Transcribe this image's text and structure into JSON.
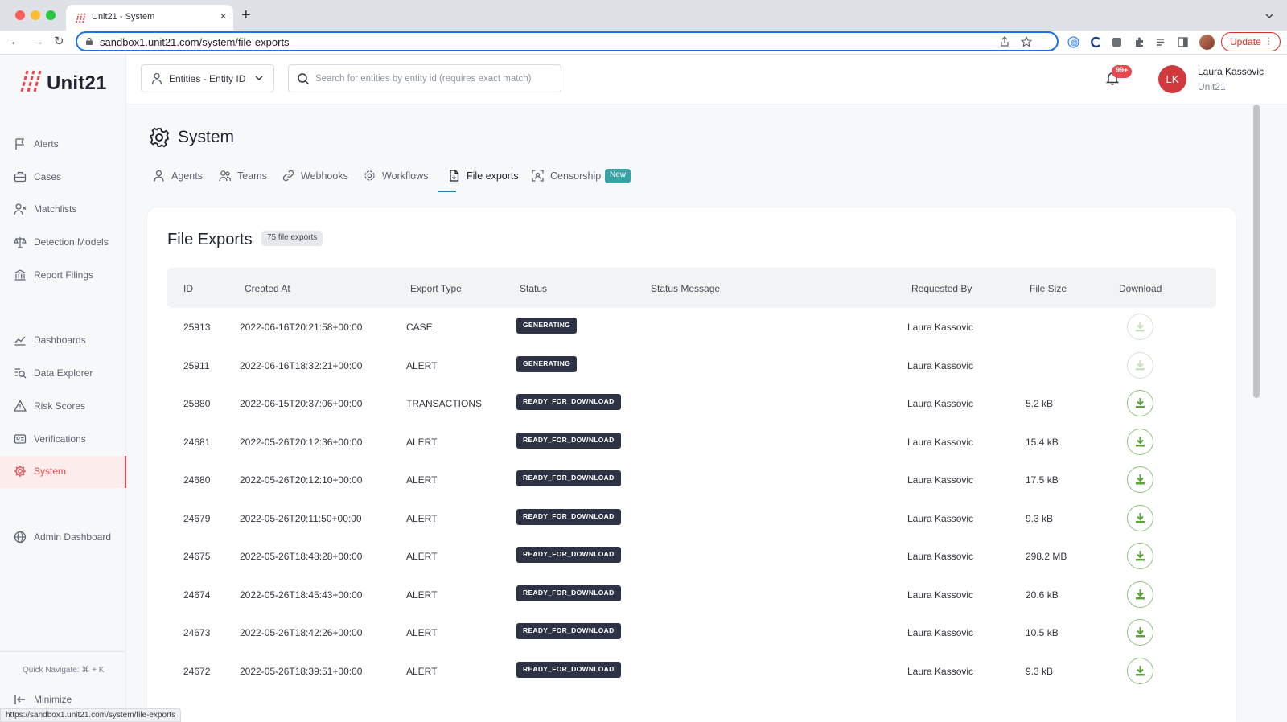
{
  "browser": {
    "tab_title": "Unit21 - System",
    "url": "sandbox1.unit21.com/system/file-exports",
    "update_label": "Update",
    "status_url": "https://sandbox1.unit21.com/system/file-exports"
  },
  "header": {
    "entity_select_label": "Entities - Entity ID",
    "search_placeholder": "Search for entities by entity id (requires exact match)",
    "notifications_count": "99+",
    "user_initials": "LK",
    "user_name": "Laura Kassovic",
    "user_org": "Unit21"
  },
  "sidebar": {
    "logo_text": "Unit21",
    "items": [
      {
        "label": "Alerts",
        "icon": "flag-icon"
      },
      {
        "label": "Cases",
        "icon": "briefcase-icon"
      },
      {
        "label": "Matchlists",
        "icon": "user-x-icon"
      },
      {
        "label": "Detection Models",
        "icon": "scale-icon"
      },
      {
        "label": "Report Filings",
        "icon": "bank-icon"
      },
      {
        "label": "Dashboards",
        "icon": "chart-line-icon"
      },
      {
        "label": "Data Explorer",
        "icon": "search-list-icon"
      },
      {
        "label": "Risk Scores",
        "icon": "warning-icon"
      },
      {
        "label": "Verifications",
        "icon": "id-card-icon"
      },
      {
        "label": "System",
        "icon": "gear-icon",
        "active": true
      },
      {
        "label": "Admin Dashboard",
        "icon": "globe-icon"
      }
    ],
    "quick_navigate": "Quick Navigate: ⌘ + K",
    "minimize_label": "Minimize"
  },
  "page": {
    "title": "System",
    "tabs": [
      {
        "label": "Agents"
      },
      {
        "label": "Teams"
      },
      {
        "label": "Webhooks"
      },
      {
        "label": "Workflows"
      },
      {
        "label": "File exports",
        "active": true
      },
      {
        "label": "Censorship",
        "badge": "New"
      }
    ]
  },
  "exports": {
    "title": "File Exports",
    "count_label": "75 file exports",
    "columns": [
      "ID",
      "Created At",
      "Export Type",
      "Status",
      "Status Message",
      "Requested By",
      "File Size",
      "Download"
    ],
    "rows": [
      {
        "id": "25913",
        "created_at": "2022-06-16T20:21:58+00:00",
        "type": "CASE",
        "status": "GENERATING",
        "message": "",
        "requested_by": "Laura Kassovic",
        "size": ""
      },
      {
        "id": "25911",
        "created_at": "2022-06-16T18:32:21+00:00",
        "type": "ALERT",
        "status": "GENERATING",
        "message": "",
        "requested_by": "Laura Kassovic",
        "size": ""
      },
      {
        "id": "25880",
        "created_at": "2022-06-15T20:37:06+00:00",
        "type": "TRANSACTIONS",
        "status": "READY_FOR_DOWNLOAD",
        "message": "",
        "requested_by": "Laura Kassovic",
        "size": "5.2 kB"
      },
      {
        "id": "24681",
        "created_at": "2022-05-26T20:12:36+00:00",
        "type": "ALERT",
        "status": "READY_FOR_DOWNLOAD",
        "message": "",
        "requested_by": "Laura Kassovic",
        "size": "15.4 kB"
      },
      {
        "id": "24680",
        "created_at": "2022-05-26T20:12:10+00:00",
        "type": "ALERT",
        "status": "READY_FOR_DOWNLOAD",
        "message": "",
        "requested_by": "Laura Kassovic",
        "size": "17.5 kB"
      },
      {
        "id": "24679",
        "created_at": "2022-05-26T20:11:50+00:00",
        "type": "ALERT",
        "status": "READY_FOR_DOWNLOAD",
        "message": "",
        "requested_by": "Laura Kassovic",
        "size": "9.3 kB"
      },
      {
        "id": "24675",
        "created_at": "2022-05-26T18:48:28+00:00",
        "type": "ALERT",
        "status": "READY_FOR_DOWNLOAD",
        "message": "",
        "requested_by": "Laura Kassovic",
        "size": "298.2 MB"
      },
      {
        "id": "24674",
        "created_at": "2022-05-26T18:45:43+00:00",
        "type": "ALERT",
        "status": "READY_FOR_DOWNLOAD",
        "message": "",
        "requested_by": "Laura Kassovic",
        "size": "20.6 kB"
      },
      {
        "id": "24673",
        "created_at": "2022-05-26T18:42:26+00:00",
        "type": "ALERT",
        "status": "READY_FOR_DOWNLOAD",
        "message": "",
        "requested_by": "Laura Kassovic",
        "size": "10.5 kB"
      },
      {
        "id": "24672",
        "created_at": "2022-05-26T18:39:51+00:00",
        "type": "ALERT",
        "status": "READY_FOR_DOWNLOAD",
        "message": "",
        "requested_by": "Laura Kassovic",
        "size": "9.3 kB"
      }
    ]
  },
  "colors": {
    "accent_red": "#e5484d",
    "tab_underline": "#2f7fa6",
    "status_pill_bg": "#2e3245",
    "download_green": "#5aa43a",
    "new_badge": "#38a3a5"
  }
}
